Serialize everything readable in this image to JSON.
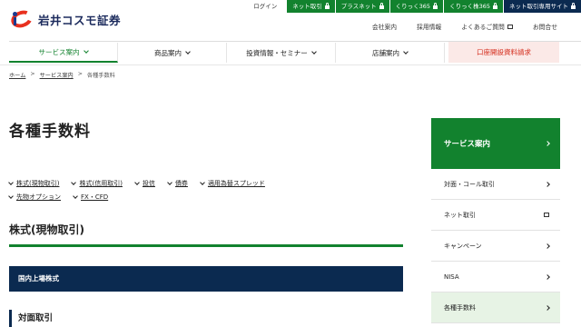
{
  "brand": {
    "name": "岩井コスモ証券"
  },
  "topbar": {
    "login": "ログイン",
    "buttons": [
      {
        "label": "ネット取引"
      },
      {
        "label": "プラスネット"
      },
      {
        "label": "くりっく365"
      },
      {
        "label": "くりっく株365"
      },
      {
        "label": "ネット取引専用サイト"
      }
    ]
  },
  "util": [
    "会社案内",
    "採用情報",
    "よくあるご質問",
    "お問合せ"
  ],
  "gnav": {
    "items": [
      "サービス案内",
      "商品案内",
      "投資情報・セミナー",
      "店舗案内"
    ],
    "request": "口座開設資料請求"
  },
  "breadcrumb": [
    "ホーム",
    "サービス案内",
    "各種手数料"
  ],
  "page_title": "各種手数料",
  "links": {
    "row1": [
      "株式(現物取引)",
      "株式(信用取引)",
      "投信",
      "債券",
      "適用為替スプレッド"
    ],
    "row2": [
      "先物オプション",
      "FX・CFD"
    ]
  },
  "section": {
    "title": "株式(現物取引)",
    "bar": "国内上場株式",
    "subtitle": "対面取引"
  },
  "side": {
    "head": "サービス案内",
    "items": [
      "対面・コール取引",
      "ネット取引",
      "キャンペーン",
      "NISA",
      "各種手数料"
    ]
  },
  "colors": {
    "green": "#12822e",
    "navy": "#0b2a50",
    "red": "#d42a1a"
  }
}
